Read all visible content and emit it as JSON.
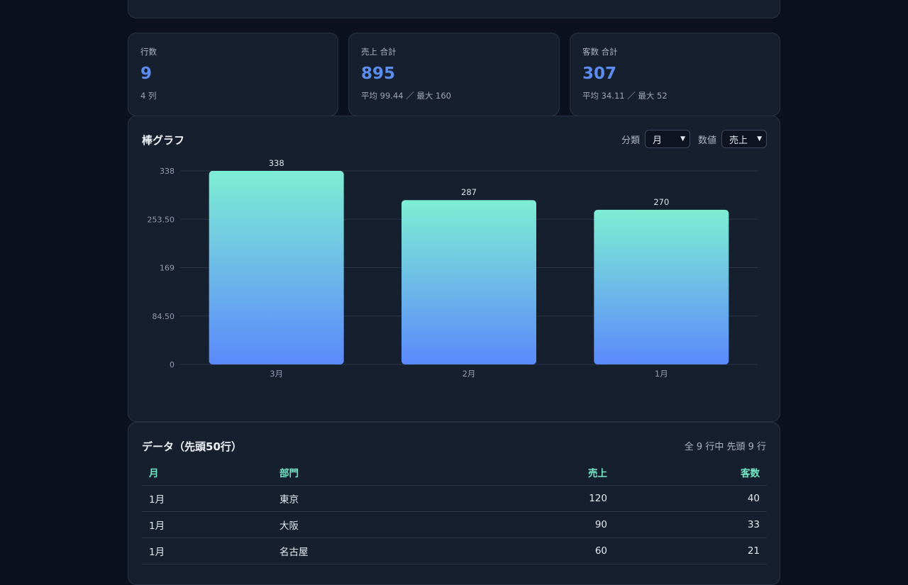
{
  "stats": [
    {
      "label": "行数",
      "value": "9",
      "sub": "4 列"
    },
    {
      "label": "売上 合計",
      "value": "895",
      "sub": "平均 99.44 ／ 最大 160"
    },
    {
      "label": "客数 合計",
      "value": "307",
      "sub": "平均 34.11 ／ 最大 52"
    }
  ],
  "chart_section": {
    "title": "棒グラフ",
    "category_label": "分類",
    "category_value": "月",
    "value_label": "数値",
    "value_value": "売上"
  },
  "chart_data": {
    "type": "bar",
    "categories": [
      "3月",
      "2月",
      "1月"
    ],
    "values": [
      338,
      287,
      270
    ],
    "ylim": [
      0,
      338
    ],
    "yticks": [
      0,
      84.5,
      169,
      253.5,
      338
    ],
    "ytick_labels": [
      "0",
      "84.50",
      "169",
      "253.50",
      "338"
    ],
    "grid": true,
    "colors": {
      "bar_top": "#7eeed3",
      "bar_bottom": "#5b89fb"
    }
  },
  "table_section": {
    "title": "データ（先頭50行）",
    "meta": "全 9 行中 先頭 9 行",
    "columns": [
      "月",
      "部門",
      "売上",
      "客数"
    ],
    "rows": [
      [
        "1月",
        "東京",
        "120",
        "40"
      ],
      [
        "1月",
        "大阪",
        "90",
        "33"
      ],
      [
        "1月",
        "名古屋",
        "60",
        "21"
      ]
    ]
  },
  "colors": {
    "accent": "#5b8def",
    "header": "#73e6c4",
    "background": "#0c121d",
    "card": "#161f2e"
  }
}
